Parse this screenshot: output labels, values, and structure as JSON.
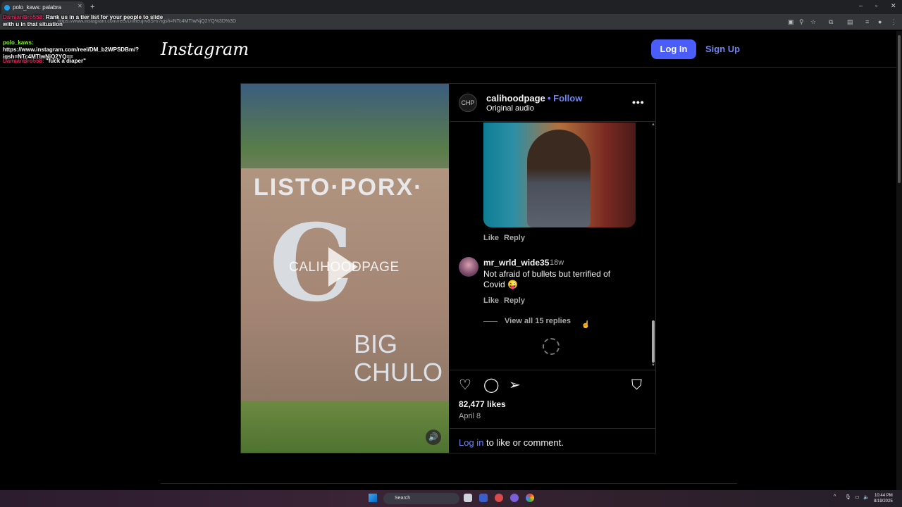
{
  "browser": {
    "tab_title": "polo_kaws: palabra",
    "url": "https://www.instagram.com/reel/DIMeujrv8SH/?igsh=NTc4MTIwNjQ2YQ%3D%3D"
  },
  "chat": [
    {
      "user": "DamianBro558:",
      "text": "Rank us in a tier list for your people to slide with u in that situation"
    },
    {
      "user": "polo_kaws:",
      "text": "https://www.instagram.com/reel/DM_b2WPSDBm/?igsh=NTc4MTIwNjQ2YQ=="
    },
    {
      "user": "DamianBro558:",
      "text": "\"fuck a diaper\""
    }
  ],
  "header": {
    "logo": "Instagram",
    "login_label": "Log In",
    "signup_label": "Sign Up"
  },
  "post": {
    "video_watermark": "CALIHOODPAGE",
    "video_graffiti_1": "LISTO·PORX·",
    "video_graffiti_2": "BIG CHULO",
    "author": "calihoodpage",
    "follow_label": "• Follow",
    "audio": "Original audio",
    "comments": [
      {
        "like_label": "Like",
        "reply_label": "Reply"
      },
      {
        "user": "mr_wrld_wide35",
        "time": "18w",
        "text": "Not afraid of bullets but terrified of Covid 😜",
        "like_label": "Like",
        "reply_label": "Reply",
        "view_replies": "View all 15 replies"
      }
    ],
    "likes": "82,477 likes",
    "date": "April 8",
    "login_cta_link": "Log in",
    "login_cta_text": " to like or comment."
  },
  "taskbar": {
    "search_label": "Search",
    "time": "10:44 PM",
    "date": "8/19/2025"
  },
  "colors": {
    "accent_blue": "#4a5df9",
    "link_blue": "#6e85f5",
    "background": "#000000"
  }
}
